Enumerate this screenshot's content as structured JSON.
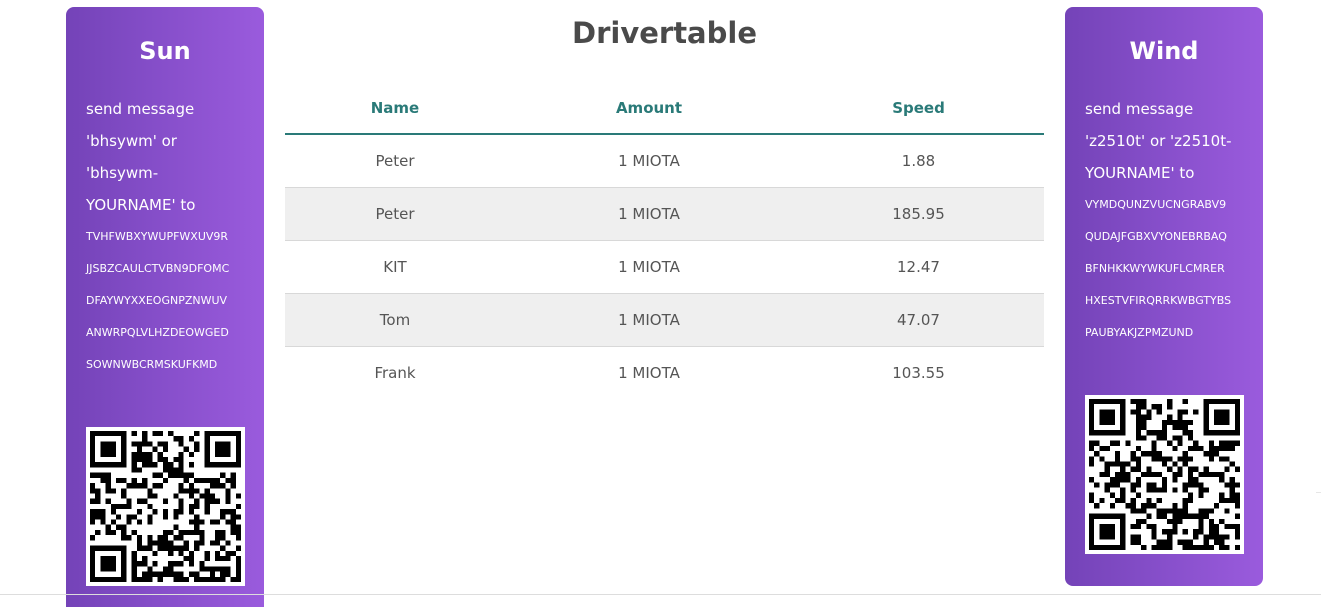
{
  "page": {
    "title": "Drivertable"
  },
  "left_card": {
    "title": "Sun",
    "message_lines": [
      "send message",
      "'bhsywm' or",
      "'bhsywm-",
      "YOURNAME' to"
    ],
    "address_lines": [
      "TVHFWBXYWUPFWXUV9R",
      "JJSBZCAULCTVBN9DFOMC",
      "DFAYWYXXEOGNPZNWUV",
      "ANWRPQLVLHZDEOWGED",
      "SOWNWBCRMSKUFKMD"
    ]
  },
  "right_card": {
    "title": "Wind",
    "message_lines": [
      "send message",
      "'z2510t' or 'z2510t-",
      "YOURNAME' to"
    ],
    "address_lines": [
      "VYMDQUNZVUCNGRABV9",
      "QUDAJFGBXVYONEBRBAQ",
      "BFNHKKWYWKUFLCMRER",
      "HXESTVFIRQRRKWBGTYBS",
      "PAUBYAKJZPMZUND"
    ]
  },
  "table": {
    "headers": {
      "name": "Name",
      "amount": "Amount",
      "speed": "Speed"
    },
    "rows": [
      {
        "name": "Peter",
        "amount": "1 MIOTA",
        "speed": "1.88"
      },
      {
        "name": "Peter",
        "amount": "1 MIOTA",
        "speed": "185.95"
      },
      {
        "name": "KIT",
        "amount": "1 MIOTA",
        "speed": "12.47"
      },
      {
        "name": "Tom",
        "amount": "1 MIOTA",
        "speed": "47.07"
      },
      {
        "name": "Frank",
        "amount": "1 MIOTA",
        "speed": "103.55"
      }
    ]
  },
  "colors": {
    "card_start": "#7443b8",
    "card_end": "#9a5bdd",
    "header_teal": "#2a7a78"
  },
  "icons": {
    "left_qr": "qr-code-icon",
    "right_qr": "qr-code-icon"
  }
}
